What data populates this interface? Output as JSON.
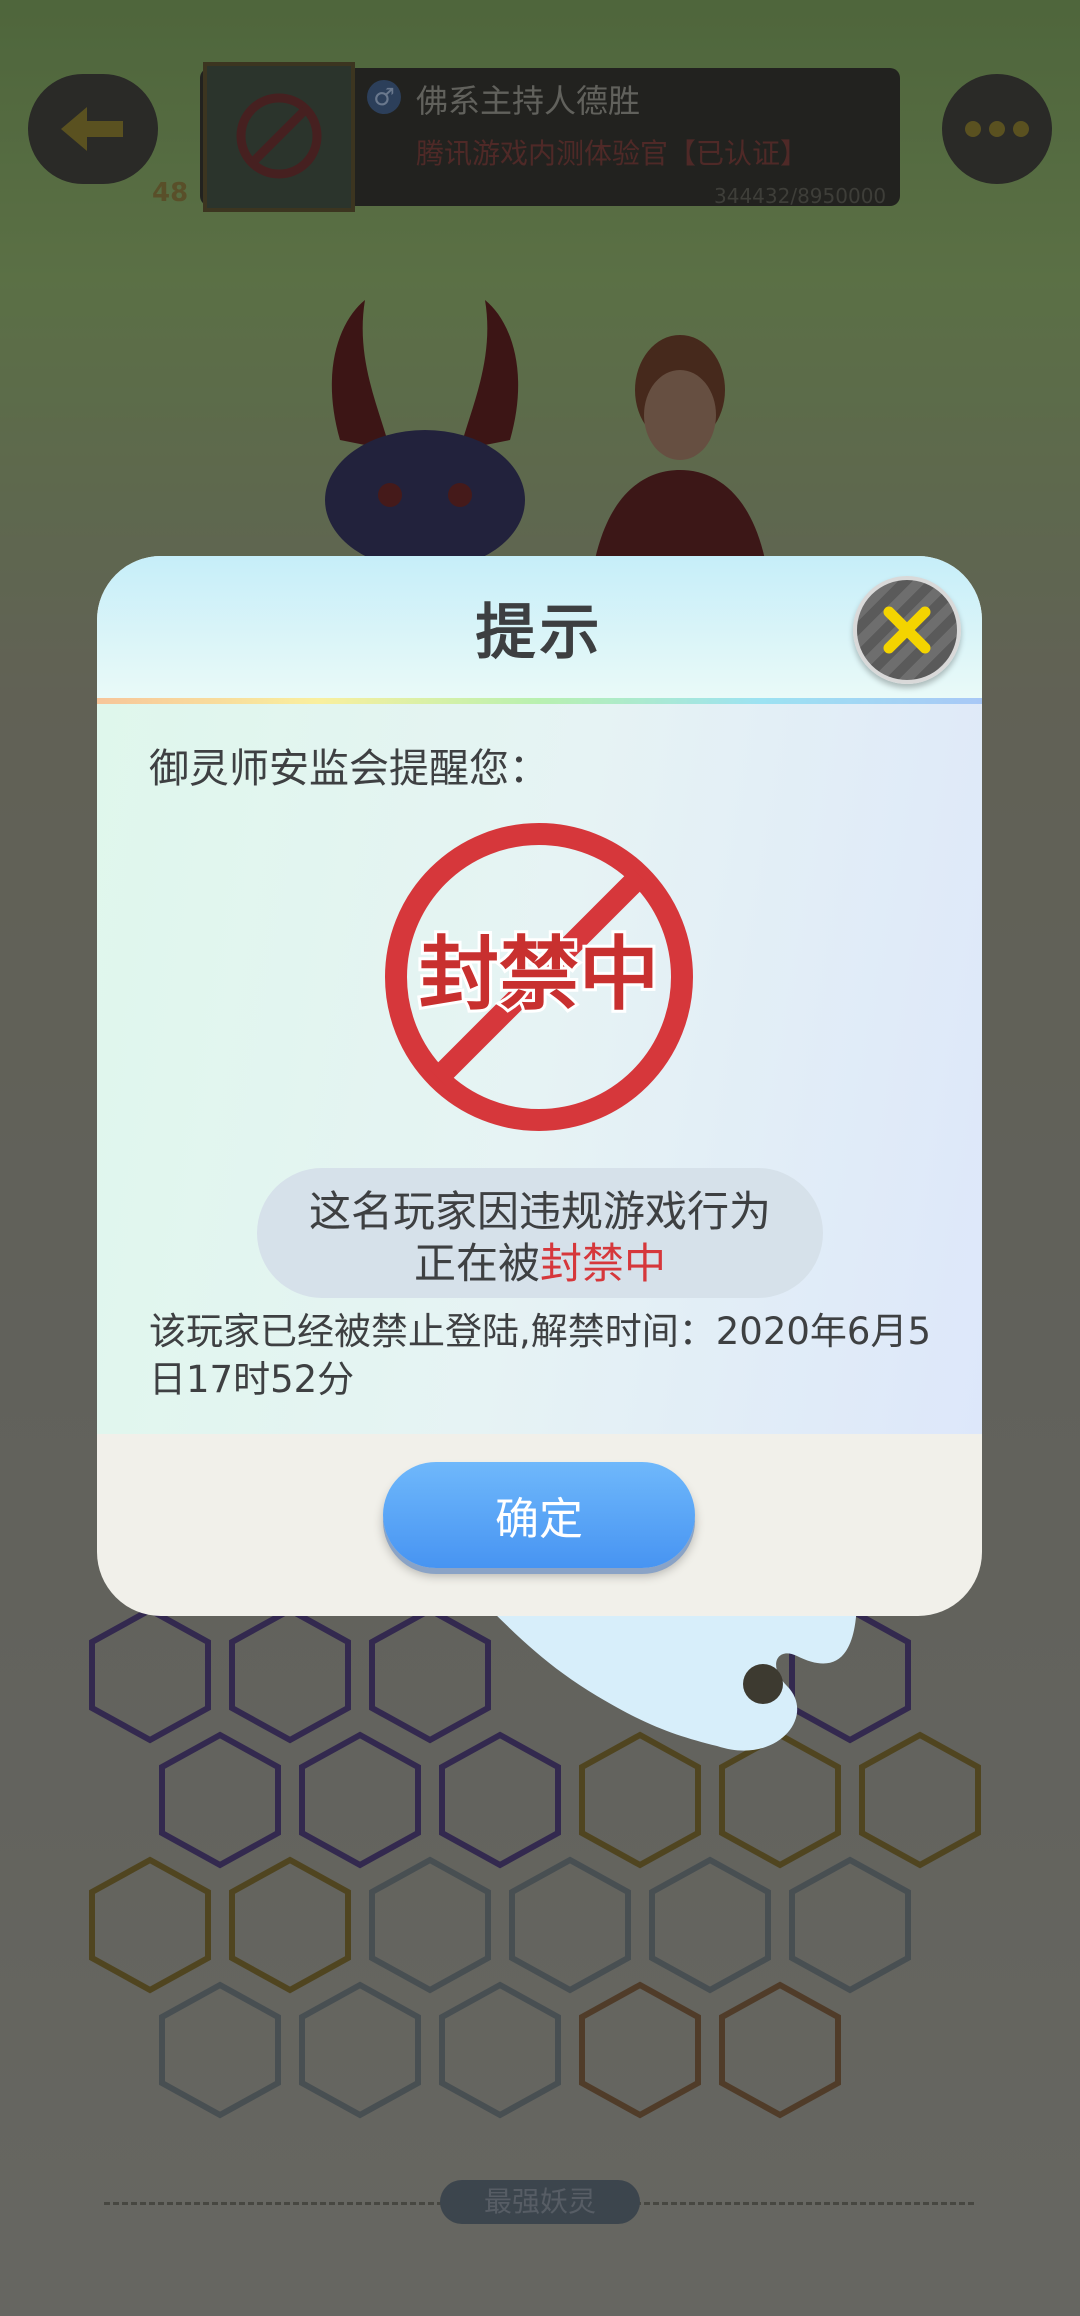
{
  "profile": {
    "gender_symbol": "♂",
    "name": "佛系主持人德胜",
    "title": "腾讯游戏内测体验官【已认证】",
    "level": "48",
    "exp": "344432/8950000"
  },
  "icons": {
    "back": "back-arrow-icon",
    "more": "more-dots-icon",
    "close": "close-x-icon",
    "ban": "ban-stamp-icon"
  },
  "section": {
    "strongest": "最强妖灵"
  },
  "dialog": {
    "title": "提示",
    "lead": "御灵师安监会提醒您：",
    "stamp_text": "封禁中",
    "status_line1": "这名玩家因违规游戏行为",
    "status_line2_prefix": "正在被",
    "status_line2_highlight": "封禁中",
    "detail": "该玩家已经被禁止登陆,解禁时间：2020年6月5日17时52分",
    "confirm_label": "确定"
  },
  "colors": {
    "accent_blue": "#4794f2",
    "ban_red": "#d6373b",
    "close_yellow": "#f4d400"
  }
}
